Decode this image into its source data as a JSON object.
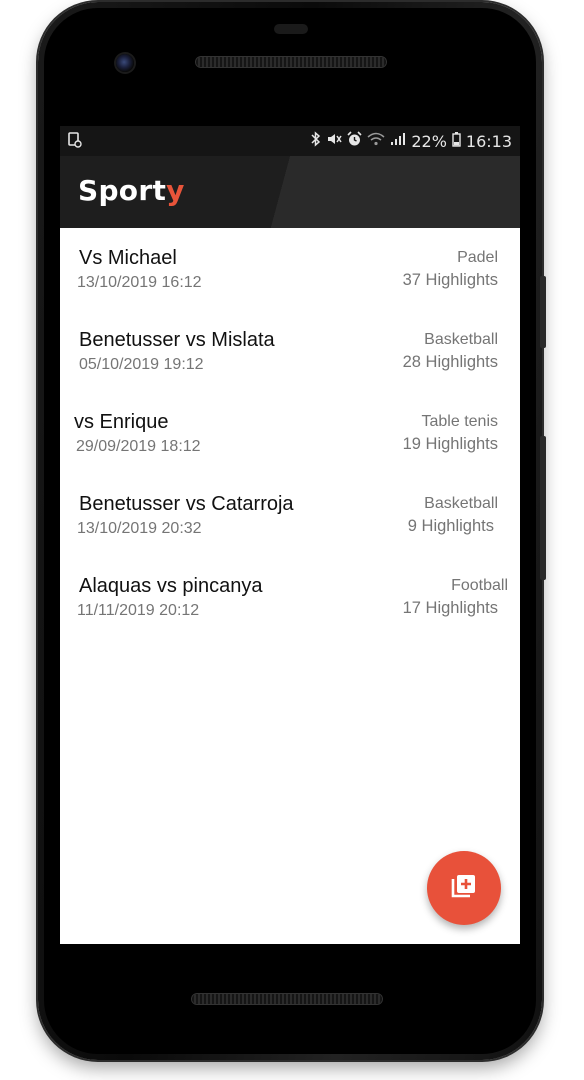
{
  "app": {
    "logo_main": "Sport",
    "logo_accent": "y",
    "accent_color": "#e8543a"
  },
  "status_bar": {
    "battery": "22%",
    "time": "16:13",
    "icons": [
      "screenshot-notification-icon",
      "bluetooth-icon",
      "mute-icon",
      "alarm-icon",
      "wifi-icon",
      "signal-icon",
      "battery-icon"
    ]
  },
  "matches": [
    {
      "title": "Vs Michael",
      "date": "13/10/2019 16:12",
      "sport": "Padel",
      "highlights": "37 Highlights"
    },
    {
      "title": "Benetusser vs Mislata",
      "date": "05/10/2019 19:12",
      "sport": "Basketball",
      "highlights": "28 Highlights"
    },
    {
      "title": "vs Enrique",
      "date": "29/09/2019 18:12",
      "sport": "Table tenis",
      "highlights": "19 Highlights"
    },
    {
      "title": "Benetusser vs Catarroja",
      "date": "13/10/2019 20:32",
      "sport": "Basketball",
      "highlights": "9 Highlights"
    },
    {
      "title": "Alaquas vs pincanya",
      "date": "11/11/2019 20:12",
      "sport": "Football",
      "highlights": "17 Highlights"
    }
  ],
  "fab": {
    "icon": "add-library-icon",
    "color": "#e8513a"
  }
}
